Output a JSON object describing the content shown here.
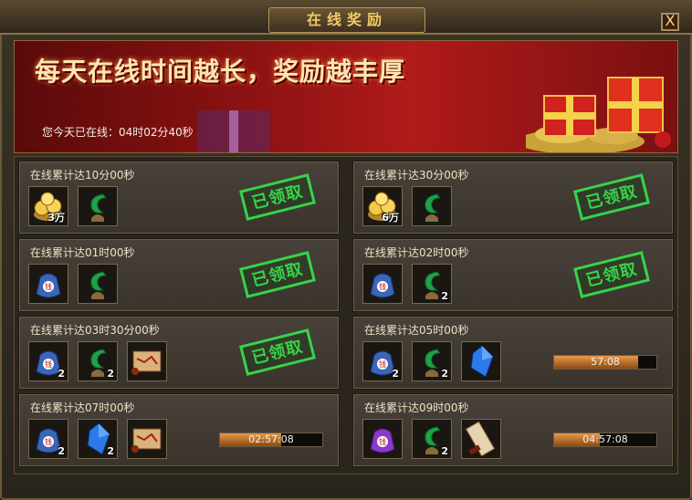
{
  "window": {
    "title": "在线奖励",
    "close_label": "X"
  },
  "banner": {
    "headline": "每天在线时间越长，奖励越丰厚",
    "online_text": "您今天已在线：04时02分40秒"
  },
  "colors": {
    "claimed_stamp": "#37d34a",
    "progress_fill": "#d6843a",
    "label": "#eee0c4"
  },
  "rewards": [
    {
      "label": "在线累计达10分00秒",
      "status": "已领取",
      "progress": null,
      "timer": "",
      "items": [
        {
          "icon": "gold-coins-icon",
          "qty": "3万"
        },
        {
          "icon": "jade-fragment-icon",
          "qty": ""
        }
      ]
    },
    {
      "label": "在线累计达30分00秒",
      "status": "已领取",
      "progress": null,
      "timer": "",
      "items": [
        {
          "icon": "gold-coins-icon",
          "qty": "6万"
        },
        {
          "icon": "jade-fragment-icon",
          "qty": ""
        }
      ]
    },
    {
      "label": "在线累计达01时00秒",
      "status": "已领取",
      "progress": null,
      "timer": "",
      "items": [
        {
          "icon": "blue-bag-icon",
          "qty": ""
        },
        {
          "icon": "jade-fragment-icon",
          "qty": ""
        }
      ]
    },
    {
      "label": "在线累计达02时00秒",
      "status": "已领取",
      "progress": null,
      "timer": "",
      "items": [
        {
          "icon": "blue-bag-icon",
          "qty": ""
        },
        {
          "icon": "jade-fragment-icon",
          "qty": "2"
        }
      ]
    },
    {
      "label": "在线累计达03时30分00秒",
      "status": "已领取",
      "progress": null,
      "timer": "",
      "items": [
        {
          "icon": "blue-bag-icon",
          "qty": "2"
        },
        {
          "icon": "jade-fragment-icon",
          "qty": "2"
        },
        {
          "icon": "scroll-map-icon",
          "qty": ""
        }
      ]
    },
    {
      "label": "在线累计达05时00秒",
      "status": "",
      "progress": 0.82,
      "timer": "57:08",
      "items": [
        {
          "icon": "blue-bag-icon",
          "qty": "2"
        },
        {
          "icon": "jade-fragment-icon",
          "qty": "2"
        },
        {
          "icon": "blue-crystal-icon",
          "qty": ""
        }
      ]
    },
    {
      "label": "在线累计达07时00秒",
      "status": "",
      "progress": 0.6,
      "timer": "02:57:08",
      "items": [
        {
          "icon": "blue-bag-icon",
          "qty": "2"
        },
        {
          "icon": "blue-crystal-icon",
          "qty": "2"
        },
        {
          "icon": "scroll-map-icon",
          "qty": ""
        }
      ]
    },
    {
      "label": "在线累计达09时00秒",
      "status": "",
      "progress": 0.45,
      "timer": "04:57:08",
      "items": [
        {
          "icon": "purple-bag-icon",
          "qty": ""
        },
        {
          "icon": "jade-fragment-icon",
          "qty": "2"
        },
        {
          "icon": "rolled-scroll-icon",
          "qty": ""
        }
      ]
    }
  ]
}
